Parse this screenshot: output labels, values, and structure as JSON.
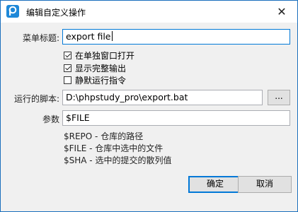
{
  "window": {
    "title": "编辑自定义操作"
  },
  "form": {
    "menu_title_label": "菜单标题:",
    "menu_title_value": "export file",
    "open_in_separate_window": {
      "label": "在单独窗口打开",
      "checked": true
    },
    "show_full_output": {
      "label": "显示完整输出",
      "checked": true
    },
    "run_silently": {
      "label": "静默运行指令",
      "checked": false
    },
    "script_label": "运行的脚本:",
    "script_value": "D:\\phpstudy_pro\\export.bat",
    "browse_label": "...",
    "params_label": "参数",
    "params_value": "$FILE"
  },
  "help": [
    "$REPO - 仓库的路径",
    "$FILE - 仓库中选中的文件",
    "$SHA - 选中的提交的散列值"
  ],
  "buttons": {
    "ok": "确定",
    "cancel": "取消"
  }
}
